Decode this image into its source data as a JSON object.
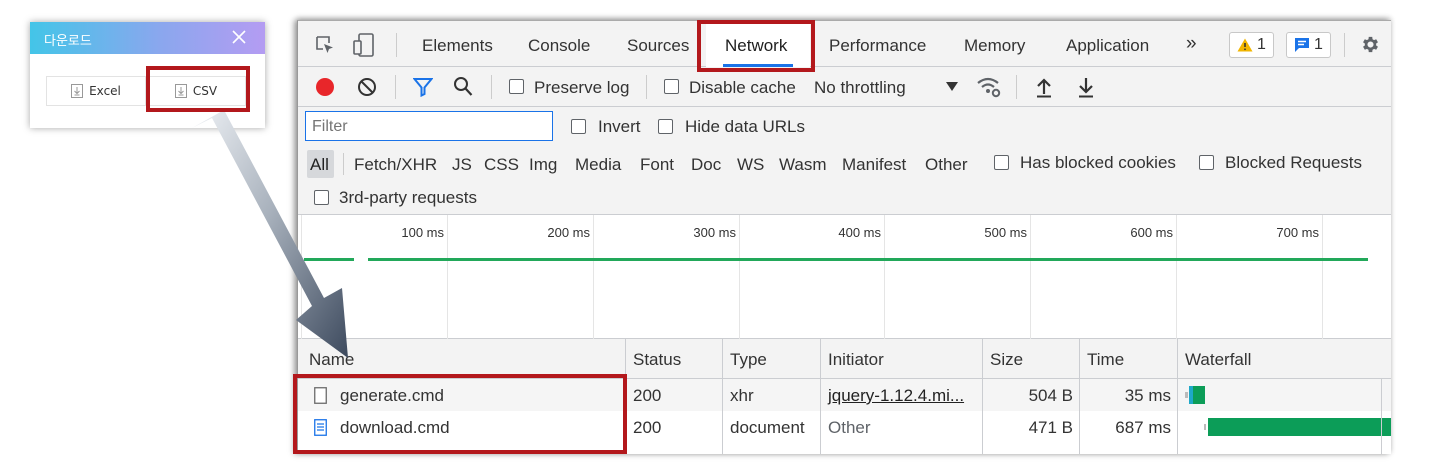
{
  "dialog": {
    "title": "다운로드",
    "buttons": [
      {
        "label": "Excel",
        "icon": "download-file-icon"
      },
      {
        "label": "CSV",
        "icon": "download-file-icon"
      }
    ]
  },
  "devtools": {
    "tabs": [
      "Elements",
      "Console",
      "Sources",
      "Network",
      "Performance",
      "Memory",
      "Application"
    ],
    "active_tab": "Network",
    "more_tabs": "»",
    "warnings_count": "1",
    "messages_count": "1",
    "toolbar": {
      "preserve_log": "Preserve log",
      "disable_cache": "Disable cache",
      "throttling": "No throttling"
    },
    "filter": {
      "placeholder": "Filter",
      "invert": "Invert",
      "hide_data_urls": "Hide data URLs",
      "types": [
        "All",
        "Fetch/XHR",
        "JS",
        "CSS",
        "Img",
        "Media",
        "Font",
        "Doc",
        "WS",
        "Wasm",
        "Manifest",
        "Other"
      ],
      "has_blocked_cookies": "Has blocked cookies",
      "blocked_requests": "Blocked Requests",
      "third_party": "3rd-party requests"
    },
    "overview_ticks": [
      "100 ms",
      "200 ms",
      "300 ms",
      "400 ms",
      "500 ms",
      "600 ms",
      "700 ms"
    ],
    "columns": [
      "Name",
      "Status",
      "Type",
      "Initiator",
      "Size",
      "Time",
      "Waterfall"
    ],
    "requests": [
      {
        "name": "generate.cmd",
        "status": "200",
        "type": "xhr",
        "initiator": "jquery-1.12.4.mi...",
        "size": "504 B",
        "time": "35 ms"
      },
      {
        "name": "download.cmd",
        "status": "200",
        "type": "document",
        "initiator": "Other",
        "size": "471 B",
        "time": "687 ms"
      }
    ]
  },
  "colors": {
    "highlight": "#b3181c",
    "accent_blue": "#1a73e8",
    "record_red": "#e8262a",
    "timeline_green": "#22a85a",
    "arrow_gray": "#58657a"
  }
}
